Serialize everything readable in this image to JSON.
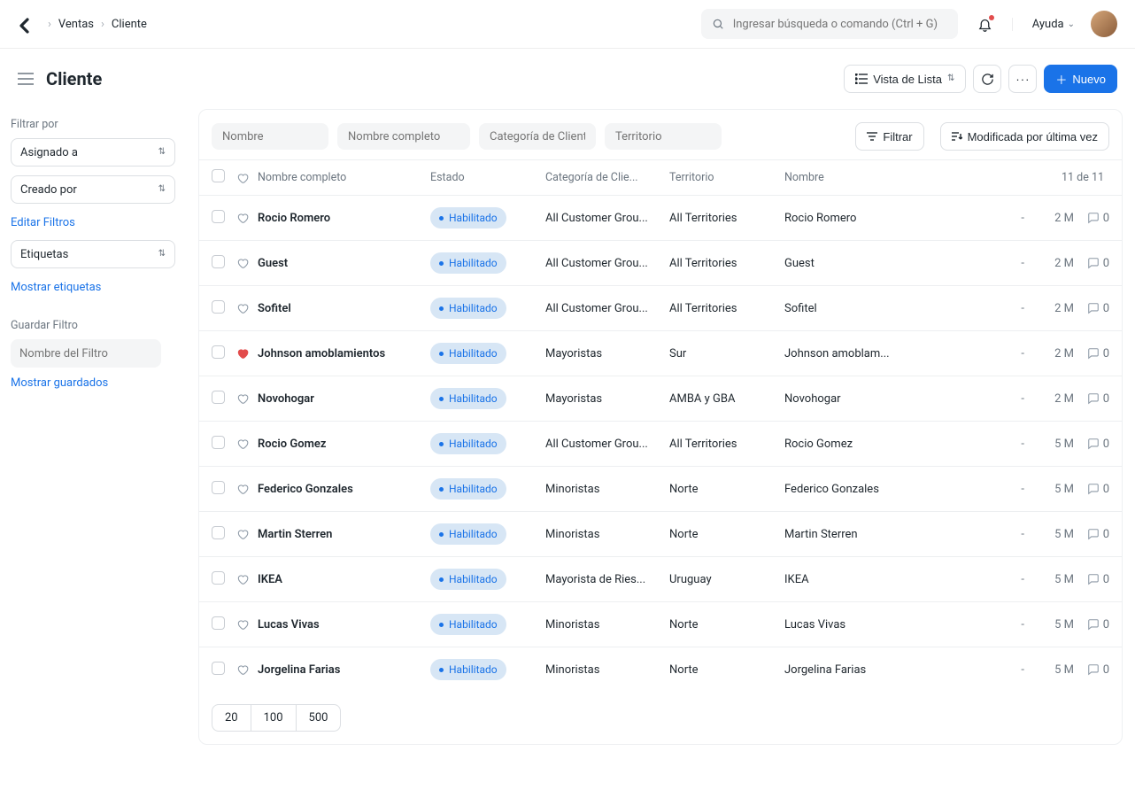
{
  "navbar": {
    "breadcrumbs": [
      "Ventas",
      "Cliente"
    ],
    "search_placeholder": "Ingresar búsqueda o comando (Ctrl + G)",
    "help_label": "Ayuda"
  },
  "header": {
    "title": "Cliente",
    "view_label": "Vista de Lista",
    "new_label": "Nuevo"
  },
  "sidebar": {
    "filter_by_label": "Filtrar por",
    "assigned_to": "Asignado a",
    "created_by": "Creado por",
    "edit_filters": "Editar Filtros",
    "tags": "Etiquetas",
    "show_tags": "Mostrar etiquetas",
    "save_filter_label": "Guardar Filtro",
    "filter_name_placeholder": "Nombre del Filtro",
    "show_saved": "Mostrar guardados"
  },
  "toolbar": {
    "tags": [
      "Nombre",
      "Nombre completo",
      "Categoría de Client",
      "Territorio"
    ],
    "filter_btn": "Filtrar",
    "sort_btn": "Modificada por última vez"
  },
  "columns": {
    "name": "Nombre completo",
    "status": "Estado",
    "category": "Categoría de Clie...",
    "territory": "Territorio",
    "id": "Nombre",
    "count": "11 de 11"
  },
  "status_label": "Habilitado",
  "rows": [
    {
      "name": "Rocio Romero",
      "cat": "All Customer Grou...",
      "terr": "All Territories",
      "id": "Rocio Romero",
      "time": "2 M",
      "liked": false,
      "comments": 0
    },
    {
      "name": "Guest",
      "cat": "All Customer Grou...",
      "terr": "All Territories",
      "id": "Guest",
      "time": "2 M",
      "liked": false,
      "comments": 0
    },
    {
      "name": "Sofitel",
      "cat": "All Customer Grou...",
      "terr": "All Territories",
      "id": "Sofitel",
      "time": "2 M",
      "liked": false,
      "comments": 0
    },
    {
      "name": "Johnson amoblamientos",
      "cat": "Mayoristas",
      "terr": "Sur",
      "id": "Johnson amoblam...",
      "time": "2 M",
      "liked": true,
      "comments": 0
    },
    {
      "name": "Novohogar",
      "cat": "Mayoristas",
      "terr": "AMBA y GBA",
      "id": "Novohogar",
      "time": "2 M",
      "liked": false,
      "comments": 0
    },
    {
      "name": "Rocio Gomez",
      "cat": "All Customer Grou...",
      "terr": "All Territories",
      "id": "Rocio Gomez",
      "time": "5 M",
      "liked": false,
      "comments": 0
    },
    {
      "name": "Federico Gonzales",
      "cat": "Minoristas",
      "terr": "Norte",
      "id": "Federico Gonzales",
      "time": "5 M",
      "liked": false,
      "comments": 0
    },
    {
      "name": "Martin Sterren",
      "cat": "Minoristas",
      "terr": "Norte",
      "id": "Martin Sterren",
      "time": "5 M",
      "liked": false,
      "comments": 0
    },
    {
      "name": "IKEA",
      "cat": "Mayorista de Ries...",
      "terr": "Uruguay",
      "id": "IKEA",
      "time": "5 M",
      "liked": false,
      "comments": 0
    },
    {
      "name": "Lucas Vivas",
      "cat": "Minoristas",
      "terr": "Norte",
      "id": "Lucas Vivas",
      "time": "5 M",
      "liked": false,
      "comments": 0
    },
    {
      "name": "Jorgelina Farias",
      "cat": "Minoristas",
      "terr": "Norte",
      "id": "Jorgelina Farias",
      "time": "5 M",
      "liked": false,
      "comments": 0
    }
  ],
  "pager": [
    "20",
    "100",
    "500"
  ]
}
